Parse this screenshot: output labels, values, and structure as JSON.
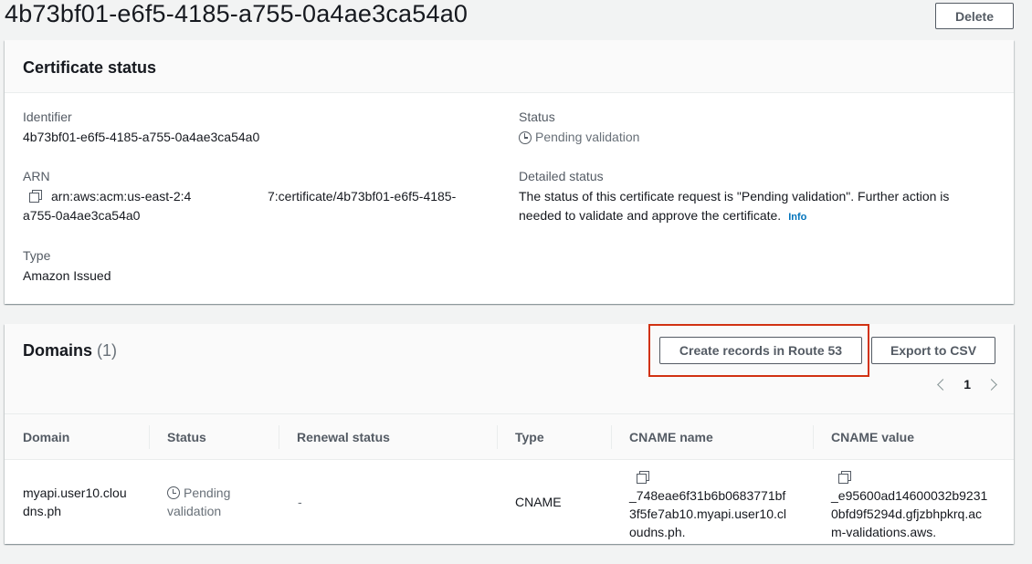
{
  "page": {
    "title": "4b73bf01-e6f5-4185-a755-0a4ae3ca54a0",
    "delete_label": "Delete"
  },
  "certificate_status": {
    "title": "Certificate status",
    "identifier_label": "Identifier",
    "identifier_value": "4b73bf01-e6f5-4185-a755-0a4ae3ca54a0",
    "arn_label": "ARN",
    "arn_line1_part1": "arn:aws:acm:us-east-2:4",
    "arn_line1_part2": "7:certificate/4b73bf01-e6f5-4185-",
    "arn_line2": "a755-0a4ae3ca54a0",
    "type_label": "Type",
    "type_value": "Amazon Issued",
    "status_label": "Status",
    "status_value": "Pending validation",
    "detailed_status_label": "Detailed status",
    "detailed_status_line1": "The status of this certificate request is \"Pending validation\". Further action is",
    "detailed_status_line2": "needed to validate and approve the certificate.",
    "info_link": "Info"
  },
  "domains": {
    "title": "Domains",
    "count": "(1)",
    "create_records_label": "Create records in Route 53",
    "export_label": "Export to CSV",
    "page_number": "1",
    "columns": [
      "Domain",
      "Status",
      "Renewal status",
      "Type",
      "CNAME name",
      "CNAME value"
    ],
    "rows": [
      {
        "domain_line1": "myapi.user10.clou",
        "domain_line2": "dns.ph",
        "status_line1": "Pending",
        "status_line2": "validation",
        "renewal_status": "-",
        "type": "CNAME",
        "cname_name_line1": "_748eae6f31b6b0683771bf",
        "cname_name_line2": "3f5fe7ab10.myapi.user10.cl",
        "cname_name_line3": "oudns.ph.",
        "cname_value_line1": "_e95600ad14600032b9231",
        "cname_value_line2": "0bfd9f5294d.gfjzbhpkrq.ac",
        "cname_value_line3": "m-validations.aws."
      }
    ]
  },
  "colors": {
    "link": "#0073bb",
    "highlight": "#d13212",
    "muted": "#687078"
  }
}
